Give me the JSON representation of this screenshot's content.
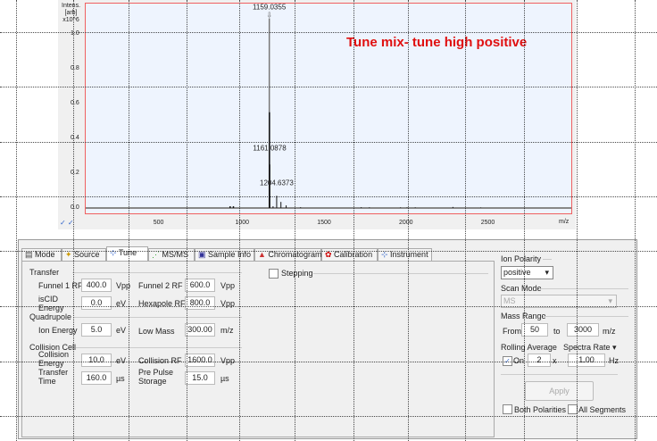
{
  "chart": {
    "y_label_lines": [
      "Intens.",
      "[arb]",
      "x10^6"
    ],
    "y_ticks": [
      "1.0",
      "0.8",
      "0.6",
      "0.4",
      "0.2",
      "0.0"
    ],
    "x_ticks": [
      "500",
      "1000",
      "1500",
      "2000",
      "2500"
    ],
    "x_unit": "m/z",
    "annotation": "Tune mix- tune high positive",
    "peak_labels": [
      "1159.0355",
      "1161.0878",
      "1204.6373"
    ],
    "accent": "#e01010",
    "peaks": [
      [
        1159,
        1.09
      ],
      [
        1160,
        0.55
      ],
      [
        1161,
        0.25
      ],
      [
        1204,
        0.07
      ],
      [
        1182,
        0.01
      ],
      [
        1230,
        0.035
      ],
      [
        1262,
        0.015
      ],
      [
        920,
        0.01
      ],
      [
        940,
        0.01
      ],
      [
        1350,
        0.004
      ],
      [
        1720,
        0.004
      ],
      [
        1770,
        0.003
      ],
      [
        1960,
        0.003
      ],
      [
        2000,
        0.003
      ],
      [
        2050,
        0.003
      ],
      [
        2280,
        0.006
      ],
      [
        2450,
        0.002
      ]
    ]
  },
  "tabs": [
    {
      "label": "Mode"
    },
    {
      "label": "Source"
    },
    {
      "label": "Tune"
    },
    {
      "label": "MS/MS"
    },
    {
      "label": "Sample Info"
    },
    {
      "label": "Chromatogram"
    },
    {
      "label": "Calibration"
    },
    {
      "label": "Instrument"
    }
  ],
  "tune": {
    "transfer": "Transfer",
    "funnel1_label": "Funnel 1 RF",
    "funnel1": "400.0",
    "funnel2_label": "Funnel 2 RF",
    "funnel2": "600.0",
    "vpp": "Vpp",
    "iscid_label": "isCID Energy",
    "iscid": "0.0",
    "ev": "eV",
    "hexapole_label": "Hexapole RF",
    "hexapole": "800.0",
    "quadrupole": "Quadrupole",
    "ion_energy_label": "Ion Energy",
    "ion_energy": "5.0",
    "low_mass_label": "Low Mass",
    "low_mass": "300.00",
    "mz": "m/z",
    "collision_cell": "Collision Cell",
    "coll_energy_label": "Collision Energy",
    "coll_energy": "10.0",
    "coll_rf_label": "Collision RF",
    "coll_rf": "1600.0",
    "transfer_time_label": "Transfer Time",
    "transfer_time": "160.0",
    "us": "µs",
    "prepulse_label": "Pre Pulse Storage",
    "prepulse": "15.0",
    "stepping": "Stepping"
  },
  "side": {
    "ion_polarity": "Ion Polarity",
    "polarity": "positive",
    "scan_mode": "Scan Mode",
    "scan_value": "MS",
    "mass_range": "Mass Range",
    "from": "From",
    "from_val": "50",
    "to": "to",
    "to_val": "3000",
    "mz": "m/z",
    "rolling": "Rolling Average",
    "spectra_rate": "Spectra Rate",
    "on": "On",
    "avg": "2",
    "x": "x",
    "rate": "1.00",
    "hz": "Hz",
    "apply": "Apply",
    "both": "Both Polarities",
    "all": "All Segments"
  }
}
